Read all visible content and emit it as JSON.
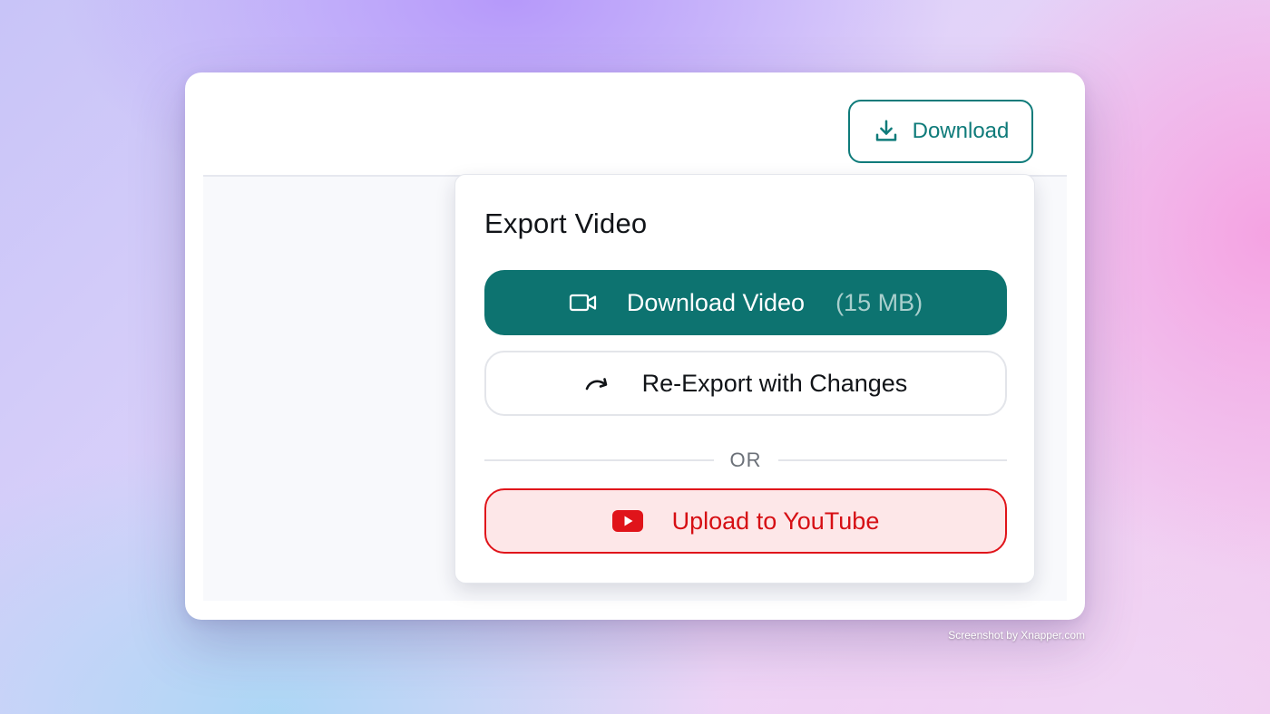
{
  "header": {
    "download_button_label": "Download",
    "download_icon": "download-icon"
  },
  "export_panel": {
    "title": "Export Video",
    "download_video": {
      "label": "Download Video",
      "size": "(15 MB)",
      "icon": "video-camera-icon"
    },
    "re_export": {
      "label": "Re-Export with Changes",
      "icon": "redo-arrow-icon"
    },
    "separator_text": "OR",
    "youtube": {
      "label": "Upload to YouTube",
      "icon": "youtube-icon"
    }
  },
  "watermark": "Screenshot by Xnapper.com",
  "colors": {
    "brand_teal": "#0d7370",
    "youtube_red": "#e0141a",
    "youtube_bg": "#fde7e8"
  }
}
